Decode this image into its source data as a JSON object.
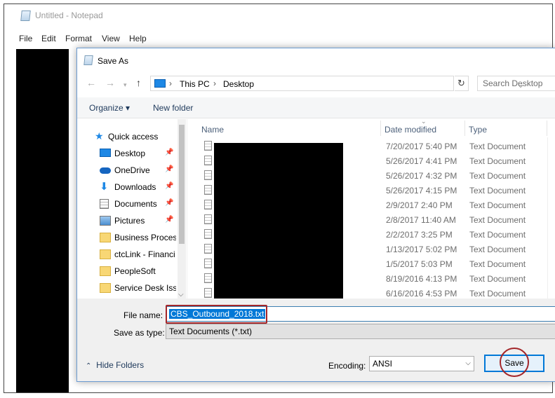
{
  "notepad": {
    "title": "Untitled - Notepad",
    "menu": [
      "File",
      "Edit",
      "Format",
      "View",
      "Help"
    ]
  },
  "dialog": {
    "title": "Save As",
    "breadcrumb": [
      "This PC",
      "Desktop"
    ],
    "search_placeholder": "Search Desktop",
    "commands": {
      "organize": "Organize ▾",
      "new_folder": "New folder"
    },
    "nav_items": [
      {
        "label": "Quick access",
        "icon": "star-icon",
        "pinned": false
      },
      {
        "label": "Desktop",
        "icon": "desktop-icon",
        "pinned": true
      },
      {
        "label": "OneDrive",
        "icon": "cloud-icon",
        "pinned": true
      },
      {
        "label": "Downloads",
        "icon": "download-icon",
        "pinned": true
      },
      {
        "label": "Documents",
        "icon": "documents-icon",
        "pinned": true
      },
      {
        "label": "Pictures",
        "icon": "pictures-icon",
        "pinned": true
      },
      {
        "label": "Business Process",
        "icon": "folder-icon",
        "pinned": false
      },
      {
        "label": "ctcLink - Financi",
        "icon": "folder-icon",
        "pinned": false
      },
      {
        "label": "PeopleSoft",
        "icon": "folder-icon",
        "pinned": false
      },
      {
        "label": "Service Desk Issu",
        "icon": "folder-icon",
        "pinned": false
      }
    ],
    "columns": {
      "name": "Name",
      "date": "Date modified",
      "type": "Type"
    },
    "files": [
      {
        "date": "7/20/2017 5:40 PM",
        "type": "Text Document"
      },
      {
        "date": "5/26/2017 4:41 PM",
        "type": "Text Document"
      },
      {
        "date": "5/26/2017 4:32 PM",
        "type": "Text Document"
      },
      {
        "date": "5/26/2017 4:15 PM",
        "type": "Text Document"
      },
      {
        "date": "2/9/2017 2:40 PM",
        "type": "Text Document"
      },
      {
        "date": "2/8/2017 11:40 AM",
        "type": "Text Document"
      },
      {
        "date": "2/2/2017 3:25 PM",
        "type": "Text Document"
      },
      {
        "date": "1/13/2017 5:02 PM",
        "type": "Text Document"
      },
      {
        "date": "1/5/2017 5:03 PM",
        "type": "Text Document"
      },
      {
        "date": "8/19/2016 4:13 PM",
        "type": "Text Document"
      },
      {
        "date": "6/16/2016 4:53 PM",
        "type": "Text Document"
      }
    ],
    "file_name_label": "File name:",
    "file_name_value": "CBS_Outbound_2018.txt",
    "save_type_label": "Save as type:",
    "save_type_value": "Text Documents (*.txt)",
    "hide_folders": "Hide Folders",
    "encoding_label": "Encoding:",
    "encoding_value": "ANSI",
    "save_label": "Save"
  },
  "colors": {
    "accent": "#0078d7",
    "annotation": "#a3262a"
  }
}
